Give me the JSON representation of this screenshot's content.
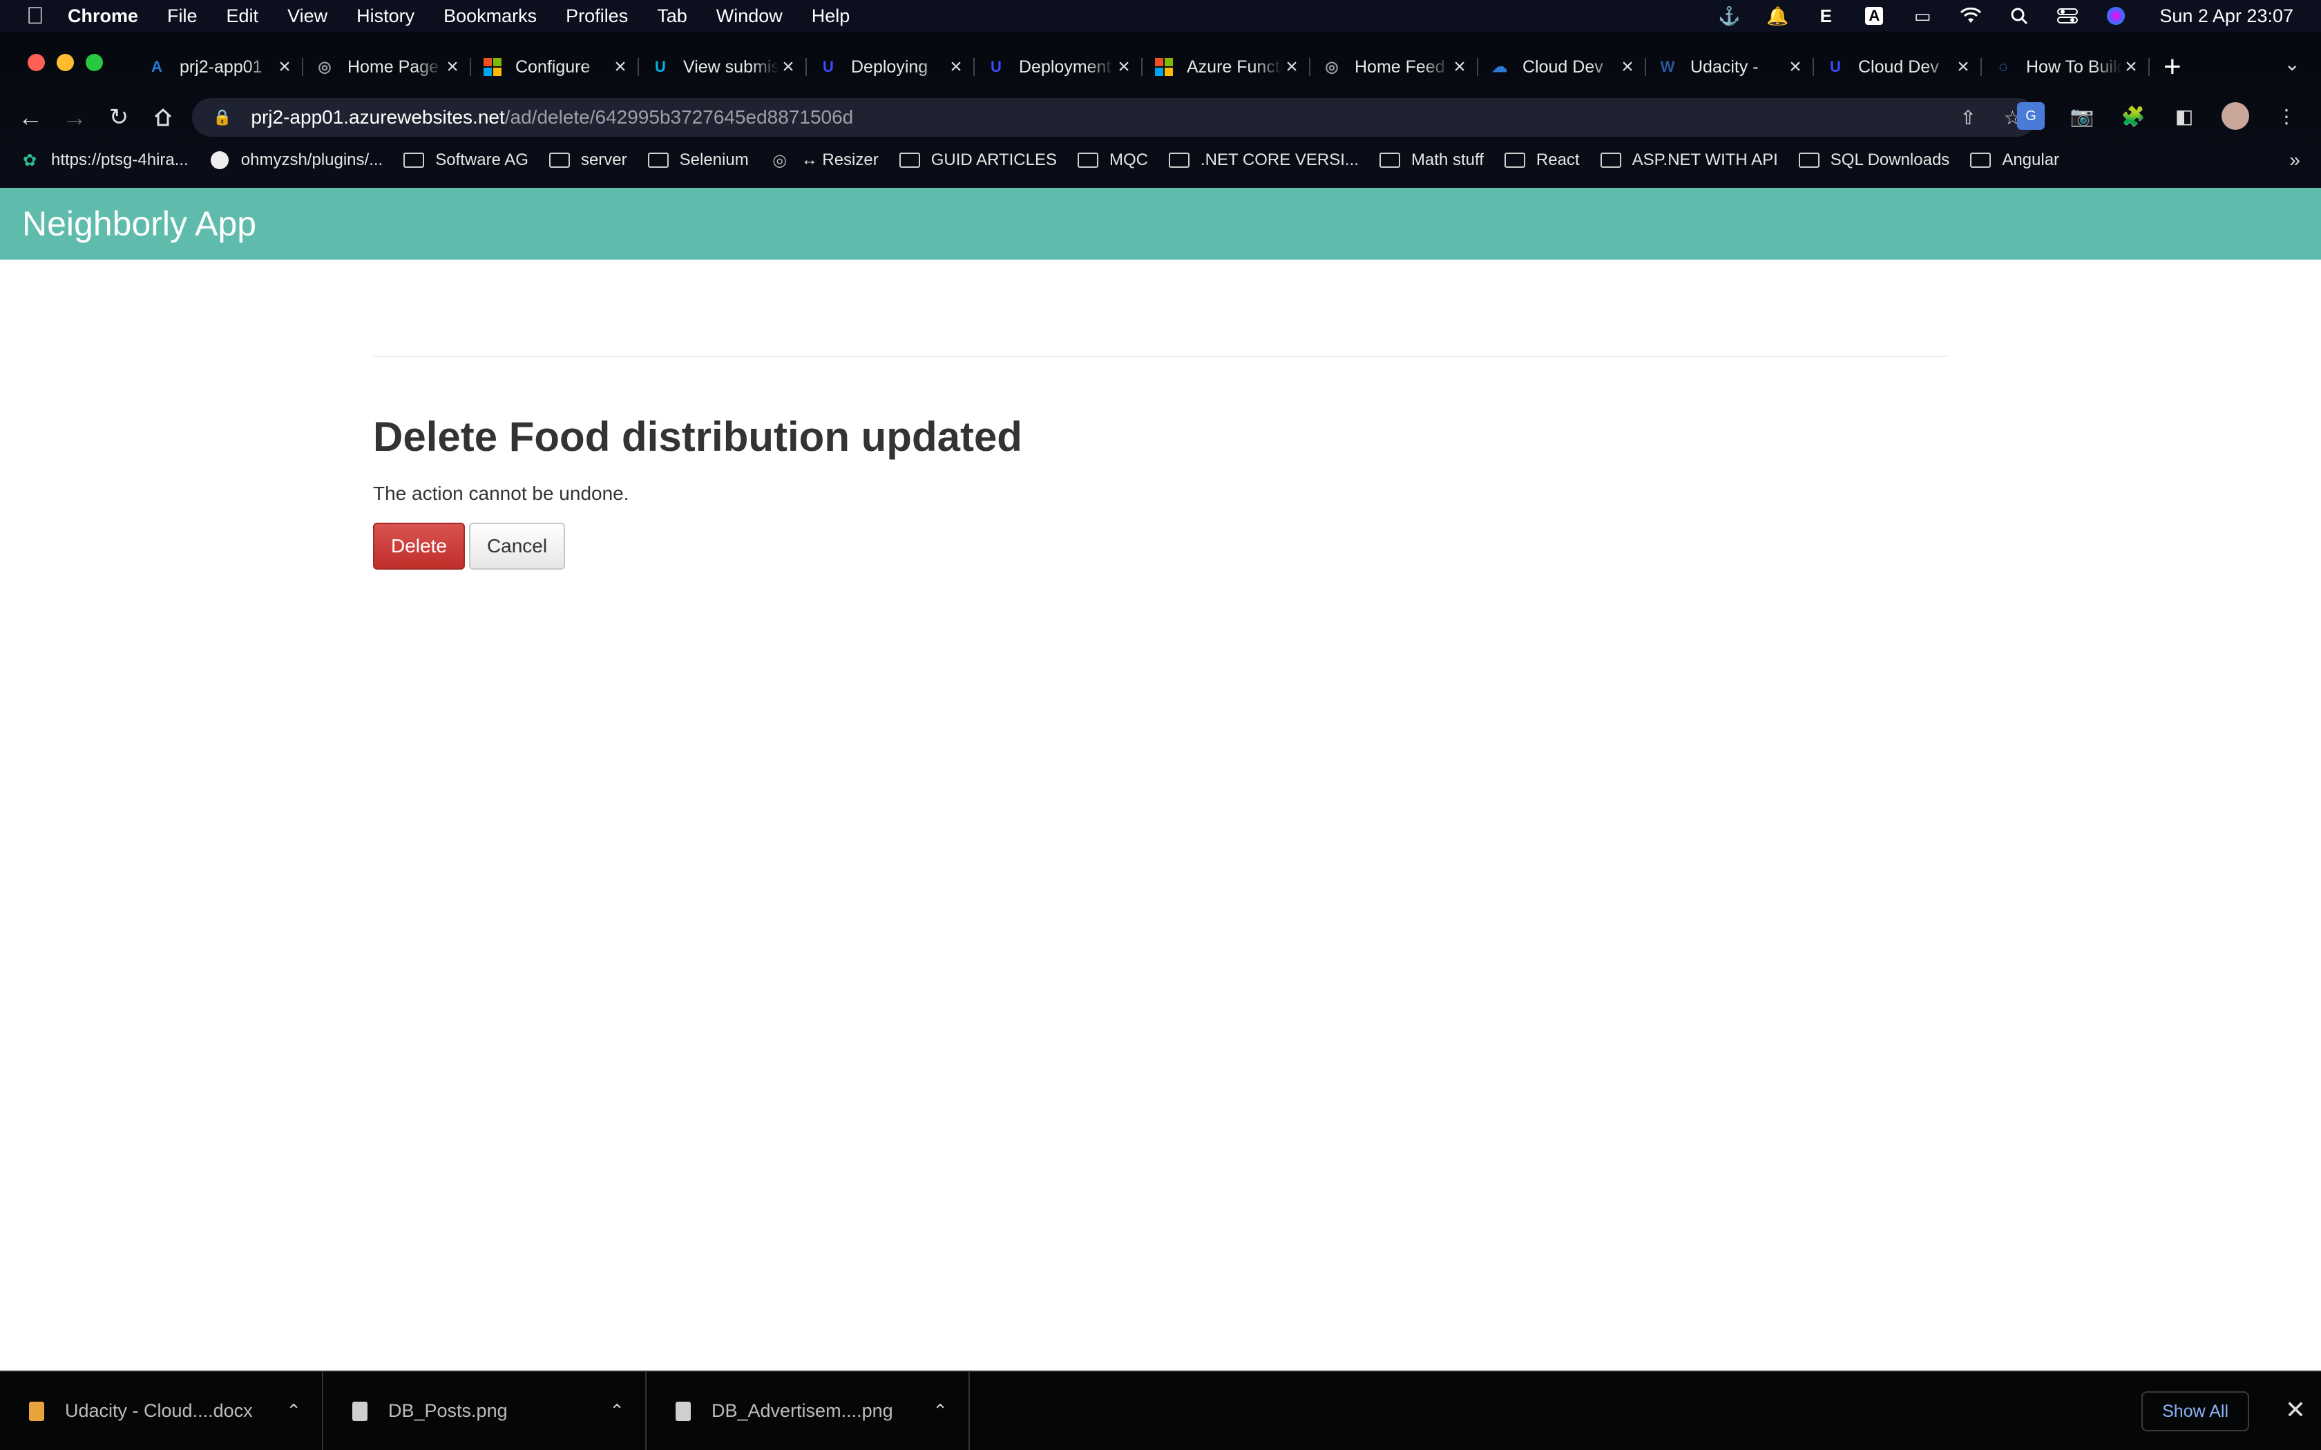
{
  "menubar": {
    "app": "Chrome",
    "items": [
      "File",
      "Edit",
      "View",
      "History",
      "Bookmarks",
      "Profiles",
      "Tab",
      "Window",
      "Help"
    ],
    "clock": "Sun 2 Apr  23:07"
  },
  "tabs": [
    {
      "title": "prj2-app01",
      "icon": "azure-icon",
      "color": "#2b7bd9"
    },
    {
      "title": "Home Page",
      "icon": "globe-icon",
      "color": "#9aa0a6"
    },
    {
      "title": "Configure",
      "icon": "microsoft-icon",
      "color": "#f25022"
    },
    {
      "title": "View submission",
      "icon": "udacity-icon",
      "color": "#02b3e4"
    },
    {
      "title": "Deploying",
      "icon": "udacity-icon",
      "color": "#3b4cff"
    },
    {
      "title": "Deployment",
      "icon": "udacity-icon",
      "color": "#3b4cff"
    },
    {
      "title": "Azure Functions",
      "icon": "microsoft-icon",
      "color": "#f25022"
    },
    {
      "title": "Home Feed",
      "icon": "globe-icon",
      "color": "#9aa0a6"
    },
    {
      "title": "Cloud Dev",
      "icon": "cloud-icon",
      "color": "#2f7bd6"
    },
    {
      "title": "Udacity -",
      "icon": "word-icon",
      "color": "#2b579a"
    },
    {
      "title": "Cloud Dev",
      "icon": "udacity-icon",
      "color": "#3b4cff"
    },
    {
      "title": "How To Build",
      "icon": "loading-icon",
      "color": "#4a8cff"
    }
  ],
  "address": {
    "host": "prj2-app01.azurewebsites.net",
    "path": "/ad/delete/642995b3727645ed8871506d"
  },
  "bookmarks": [
    {
      "label": "https://ptsg-4hira...",
      "icon": "leaf-icon"
    },
    {
      "label": "ohmyzsh/plugins/...",
      "icon": "github-icon"
    },
    {
      "label": "Software AG",
      "icon": "folder-icon"
    },
    {
      "label": "server",
      "icon": "folder-icon"
    },
    {
      "label": "Selenium",
      "icon": "folder-icon"
    },
    {
      "label": "↔ Resizer",
      "icon": "globe-icon"
    },
    {
      "label": "GUID ARTICLES",
      "icon": "folder-icon"
    },
    {
      "label": "MQC",
      "icon": "folder-icon"
    },
    {
      "label": ".NET CORE VERSI...",
      "icon": "folder-icon"
    },
    {
      "label": "Math stuff",
      "icon": "folder-icon"
    },
    {
      "label": "React",
      "icon": "folder-icon"
    },
    {
      "label": "ASP.NET WITH API",
      "icon": "folder-icon"
    },
    {
      "label": "SQL Downloads",
      "icon": "folder-icon"
    },
    {
      "label": "Angular",
      "icon": "folder-icon"
    }
  ],
  "app": {
    "title": "Neighborly App",
    "header_color": "#5fbcad"
  },
  "content": {
    "heading": "Delete Food distribution updated",
    "note": "The action cannot be undone.",
    "delete_label": "Delete",
    "cancel_label": "Cancel"
  },
  "downloads": {
    "items": [
      {
        "name": "Udacity - Cloud....docx",
        "color": "#e8a33a"
      },
      {
        "name": "DB_Posts.png",
        "color": "#cfcfcf"
      },
      {
        "name": "DB_Advertisem....png",
        "color": "#cfcfcf"
      }
    ],
    "show_all": "Show All"
  }
}
